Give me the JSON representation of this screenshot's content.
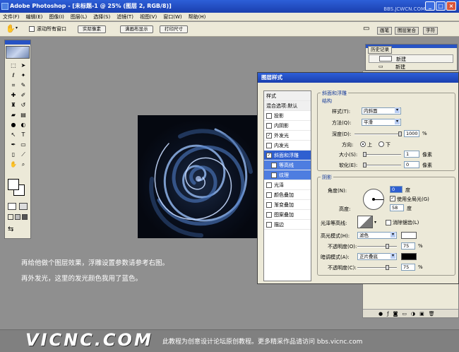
{
  "window": {
    "title": "Adobe Photoshop - [未标题-1 @ 25% (图层 2, RGB/8)]",
    "watermark": "BBS.JCWCN.COM"
  },
  "menu": [
    "文件(F)",
    "编辑(E)",
    "图像(I)",
    "图层(L)",
    "选择(S)",
    "滤镜(T)",
    "视图(V)",
    "窗口(W)",
    "帮助(H)"
  ],
  "options": {
    "checkbox_label": "滚动所有窗口",
    "btn_actual": "实际像素",
    "btn_fit": "满画布显示",
    "btn_print": "打印尺寸"
  },
  "palette_tabs": [
    "画笔",
    "图层复合",
    "字符"
  ],
  "history": {
    "tab": "历史记录",
    "row1": "新建",
    "row2": "新建"
  },
  "captions": {
    "line1": "再给他做个图层效果，浮雕设置参数请参考右图。",
    "line2": "再外发光，这里的发光颜色我用了蓝色。"
  },
  "dialog": {
    "title": "图层样式",
    "styles_header": "样式",
    "blend_options": "混合选项:默认",
    "style_items": [
      {
        "label": "投影",
        "checked": false
      },
      {
        "label": "内阴影",
        "checked": false
      },
      {
        "label": "外发光",
        "checked": true
      },
      {
        "label": "内发光",
        "checked": false
      },
      {
        "label": "斜面和浮雕",
        "checked": true,
        "selected": true
      },
      {
        "label": "等高线",
        "checked": false,
        "sub": true
      },
      {
        "label": "纹理",
        "checked": false,
        "sub": true
      },
      {
        "label": "光泽",
        "checked": false
      },
      {
        "label": "颜色叠加",
        "checked": false
      },
      {
        "label": "渐变叠加",
        "checked": false
      },
      {
        "label": "图案叠加",
        "checked": false
      },
      {
        "label": "描边",
        "checked": false
      }
    ],
    "bevel": {
      "group": "斜面和浮雕",
      "structure": "结构",
      "style_label": "样式(T):",
      "style_value": "内斜面",
      "method_label": "方法(Q):",
      "method_value": "平滑",
      "depth_label": "深度(D):",
      "depth_value": "1000",
      "depth_unit": "%",
      "dir_label": "方向:",
      "dir_up": "上",
      "dir_down": "下",
      "size_label": "大小(S):",
      "size_value": "1",
      "size_unit": "像素",
      "soften_label": "软化(E):",
      "soften_value": "0",
      "soften_unit": "像素"
    },
    "shading": {
      "group": "阴影",
      "angle_label": "角度(N):",
      "angle_value": "0",
      "angle_unit": "度",
      "global_light": "使用全局光(G)",
      "altitude_label": "高度:",
      "altitude_value": "58",
      "altitude_unit": "度",
      "gloss_label": "光泽等高线:",
      "antialias": "消除锯齿(L)",
      "hl_mode_label": "高光模式(H):",
      "hl_mode_value": "滤色",
      "hl_color": "#ffffff",
      "hl_opacity_label": "不透明度(O):",
      "hl_opacity_value": "75",
      "hl_opacity_unit": "%",
      "sh_mode_label": "暗调模式(A):",
      "sh_mode_value": "正片叠底",
      "sh_color": "#000000",
      "sh_opacity_label": "不透明度(C):",
      "sh_opacity_value": "75",
      "sh_opacity_unit": "%"
    }
  },
  "footer": {
    "logo": "VICNC.COM",
    "text": "此教程为创意设计论坛原创教程。更多精采作品请访问 bbs.vicnc.com"
  }
}
